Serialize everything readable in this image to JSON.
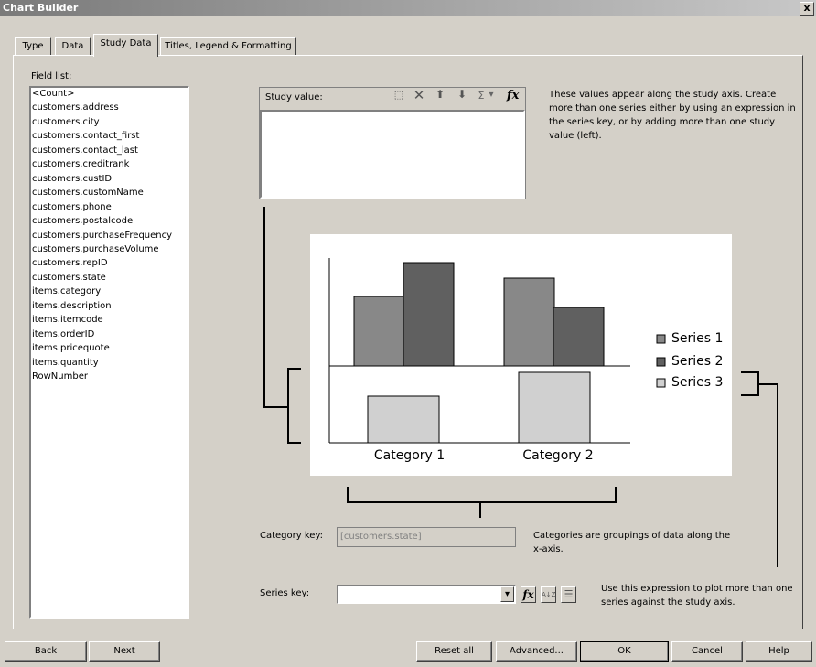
{
  "window": {
    "title": "Chart Builder",
    "close_glyph": "x"
  },
  "tabs": [
    {
      "label": "Type"
    },
    {
      "label": "Data"
    },
    {
      "label": "Study Data"
    },
    {
      "label": "Titles, Legend & Formatting"
    }
  ],
  "active_tab": "Study Data",
  "field_list": {
    "label": "Field list:",
    "items": [
      "<Count>",
      "customers.address",
      "customers.city",
      "customers.contact_first",
      "customers.contact_last",
      "customers.creditrank",
      "customers.custID",
      "customers.customName",
      "customers.phone",
      "customers.postalcode",
      "customers.purchaseFrequency",
      "customers.purchaseVolume",
      "customers.repID",
      "customers.state",
      "items.category",
      "items.description",
      "items.itemcode",
      "items.orderID",
      "items.pricequote",
      "items.quantity",
      "RowNumber"
    ]
  },
  "study_value": {
    "label": "Study value:",
    "description": "These values appear along the study axis. Create more than one series either by using an expression in the series key, or by adding more than one study value (left).",
    "toolbar": {
      "new_glyph": "⬚",
      "delete_glyph": "✕",
      "up_glyph": "⬆",
      "down_glyph": "⬇",
      "sigma_glyph": "Σ",
      "dropdown_glyph": "▾",
      "fx_glyph": "fx"
    }
  },
  "preview": {
    "categories": [
      "Category 1",
      "Category 2"
    ],
    "legend": [
      "Series 1",
      "Series 2",
      "Series 3"
    ],
    "colors": {
      "series1": "#888888",
      "series2": "#606060",
      "series3": "#d0d0d0"
    }
  },
  "category_key": {
    "label": "Category key:",
    "value": "[customers.state]",
    "description": "Categories are groupings of data along the x-axis."
  },
  "series_key": {
    "label": "Series key:",
    "value": "",
    "description": "Use this expression to plot more than one series against the study axis.",
    "fx_glyph": "fx",
    "sort_glyph": "A↓Z",
    "group_glyph": "☰",
    "dropdown_glyph": "▾"
  },
  "buttons": {
    "back": "Back",
    "next": "Next",
    "reset": "Reset all",
    "advanced": "Advanced...",
    "ok": "OK",
    "cancel": "Cancel",
    "help": "Help"
  }
}
